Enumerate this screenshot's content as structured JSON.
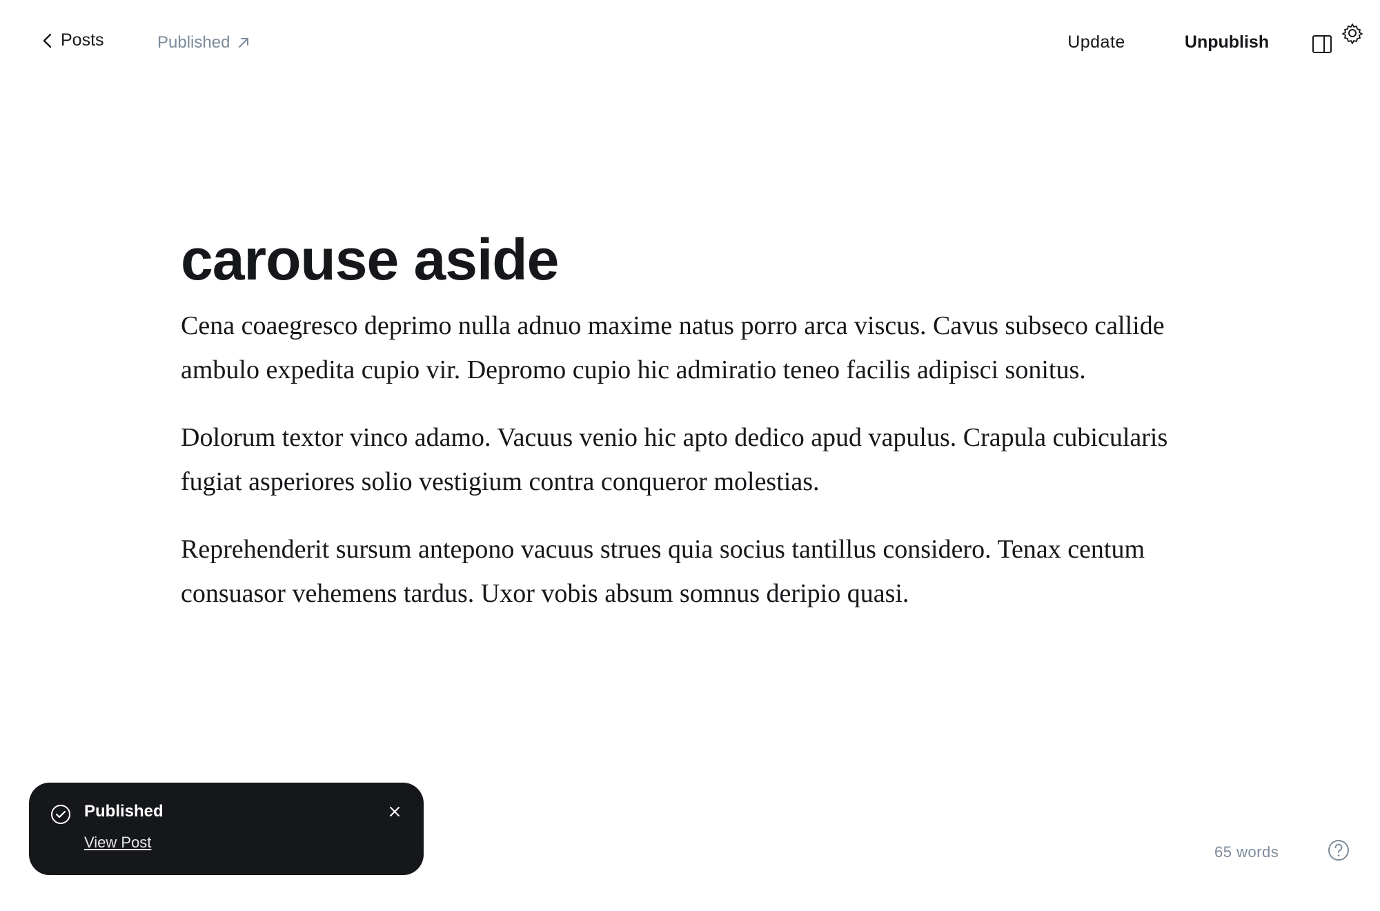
{
  "header": {
    "back_label": "Posts",
    "status_label": "Published",
    "update_label": "Update",
    "unpublish_label": "Unpublish"
  },
  "editor": {
    "title": "carouse aside",
    "paragraphs": [
      "Cena coaegresco deprimo nulla adnuo maxime natus porro arca viscus. Cavus subseco callide ambulo expedita cupio vir. Depromo cupio hic admiratio teneo facilis adipisci sonitus.",
      "Dolorum textor vinco adamo. Vacuus venio hic apto dedico apud vapulus. Crapula cubicularis fugiat asperiores solio vestigium contra conqueror molestias.",
      "Reprehenderit sursum antepono vacuus strues quia socius tantillus considero. Tenax centum consuasor vehemens tardus. Uxor vobis absum somnus deripio quasi."
    ]
  },
  "toast": {
    "title": "Published",
    "link": "View Post"
  },
  "footer": {
    "word_count": "65 words"
  },
  "icons": {
    "back": "chevron-left-icon",
    "external": "arrow-up-right-icon",
    "sidebar": "sidebar-icon",
    "settings": "gear-icon",
    "check": "check-circle-icon",
    "close": "close-icon",
    "help": "question-circle-icon"
  },
  "colors": {
    "text": "#15171a",
    "muted": "#7c8b9a",
    "toast_bg": "#15171a",
    "background": "#ffffff"
  }
}
